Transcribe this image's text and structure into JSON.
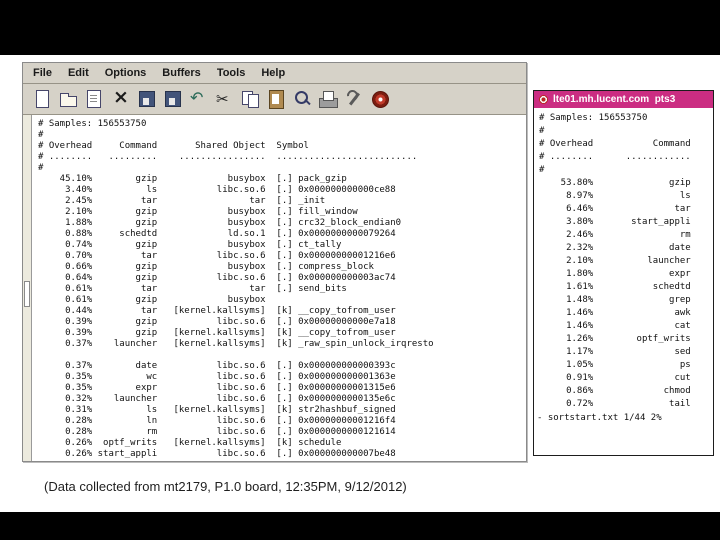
{
  "slide": {
    "caption": "(Data collected from mt2179, P1.0 board, 12:35PM, 9/12/2012)"
  },
  "editor": {
    "menu": [
      "File",
      "Edit",
      "Options",
      "Buffers",
      "Tools",
      "Help"
    ],
    "toolbar_icons": [
      "new-file",
      "open-folder",
      "dired",
      "close-buffer",
      "save",
      "save-as",
      "undo",
      "cut",
      "copy",
      "paste",
      "search",
      "print",
      "customize",
      "help"
    ],
    "lines": [
      {
        "full": "# Samples: 156553750"
      },
      {
        "full": "#"
      },
      {
        "overhead": "# Overhead",
        "command": "Command",
        "object": "Shared Object",
        "symbol": "Symbol"
      },
      {
        "overhead": "# ........",
        "command": ".........",
        "object": "................",
        "symbol": ".........................."
      },
      {
        "full": "#"
      },
      {
        "overhead": "45.10%",
        "command": "gzip",
        "object": "busybox",
        "symbol": "[.] pack_gzip"
      },
      {
        "overhead": "3.40%",
        "command": "ls",
        "object": "libc.so.6",
        "symbol": "[.] 0x000000000000ce88"
      },
      {
        "overhead": "2.45%",
        "command": "tar",
        "object": "tar",
        "symbol": "[.] _init"
      },
      {
        "overhead": "2.10%",
        "command": "gzip",
        "object": "busybox",
        "symbol": "[.] fill_window"
      },
      {
        "overhead": "1.88%",
        "command": "gzip",
        "object": "busybox",
        "symbol": "[.] crc32_block_endian0"
      },
      {
        "overhead": "0.88%",
        "command": "schedtd",
        "object": "ld.so.1",
        "symbol": "[.] 0x0000000000079264"
      },
      {
        "overhead": "0.74%",
        "command": "gzip",
        "object": "busybox",
        "symbol": "[.] ct_tally"
      },
      {
        "overhead": "0.70%",
        "command": "tar",
        "object": "libc.so.6",
        "symbol": "[.] 0x00000000001216e6"
      },
      {
        "overhead": "0.66%",
        "command": "gzip",
        "object": "busybox",
        "symbol": "[.] compress_block"
      },
      {
        "overhead": "0.64%",
        "command": "gzip",
        "object": "libc.so.6",
        "symbol": "[.] 0x000000000003ac74"
      },
      {
        "overhead": "0.61%",
        "command": "tar",
        "object": "tar",
        "symbol": "[.] send_bits"
      },
      {
        "overhead": "0.61%",
        "command": "gzip",
        "object": "busybox",
        "symbol": ""
      },
      {
        "overhead": "0.44%",
        "command": "tar",
        "object": "[kernel.kallsyms]",
        "symbol": "[k] __copy_tofrom_user"
      },
      {
        "overhead": "0.39%",
        "command": "gzip",
        "object": "libc.so.6",
        "symbol": "[.] 0x00000000000e7a18"
      },
      {
        "overhead": "0.39%",
        "command": "gzip",
        "object": "[kernel.kallsyms]",
        "symbol": "[k] __copy_tofrom_user"
      },
      {
        "overhead": "0.37%",
        "command": "launcher",
        "object": "[kernel.kallsyms]",
        "symbol": "[k] _raw_spin_unlock_irqresto"
      },
      {
        "full": ""
      },
      {
        "overhead": "0.37%",
        "command": "date",
        "object": "libc.so.6",
        "symbol": "[.] 0x000000000000393c"
      },
      {
        "overhead": "0.35%",
        "command": "wc",
        "object": "libc.so.6",
        "symbol": "[.] 0x000000000001363e"
      },
      {
        "overhead": "0.35%",
        "command": "expr",
        "object": "libc.so.6",
        "symbol": "[.] 0x00000000001315e6"
      },
      {
        "overhead": "0.32%",
        "command": "launcher",
        "object": "libc.so.6",
        "symbol": "[.] 0x0000000000135e6c"
      },
      {
        "overhead": "0.31%",
        "command": "ls",
        "object": "[kernel.kallsyms]",
        "symbol": "[k] str2hashbuf_signed"
      },
      {
        "overhead": "0.28%",
        "command": "ln",
        "object": "libc.so.6",
        "symbol": "[.] 0x00000000001216f4"
      },
      {
        "overhead": "0.28%",
        "command": "rm",
        "object": "libc.so.6",
        "symbol": "[.] 0x0000000000121614"
      },
      {
        "overhead": "0.26%",
        "command": "optf_writs",
        "object": "[kernel.kallsyms]",
        "symbol": "[k] schedule"
      },
      {
        "overhead": "0.26%",
        "command": "start_appli",
        "object": "libc.so.6",
        "symbol": "[.] 0x000000000007be48"
      }
    ]
  },
  "terminal": {
    "title": "lte01.mh.lucent.com  pts3",
    "lines": [
      {
        "full": "# Samples: 156553750"
      },
      {
        "full": "#"
      },
      {
        "overhead": "# Overhead",
        "command": "Command"
      },
      {
        "overhead": "# ........",
        "command": "............"
      },
      {
        "full": "#"
      },
      {
        "overhead": "53.80%",
        "command": "gzip"
      },
      {
        "overhead": "8.97%",
        "command": "ls"
      },
      {
        "overhead": "6.46%",
        "command": "tar"
      },
      {
        "overhead": "3.80%",
        "command": "start_appli"
      },
      {
        "overhead": "2.46%",
        "command": "rm"
      },
      {
        "overhead": "2.32%",
        "command": "date"
      },
      {
        "overhead": "2.10%",
        "command": "launcher"
      },
      {
        "overhead": "1.80%",
        "command": "expr"
      },
      {
        "overhead": "1.61%",
        "command": "schedtd"
      },
      {
        "overhead": "1.48%",
        "command": "grep"
      },
      {
        "overhead": "1.46%",
        "command": "awk"
      },
      {
        "overhead": "1.46%",
        "command": "cat"
      },
      {
        "overhead": "1.26%",
        "command": "optf_writs"
      },
      {
        "overhead": "1.17%",
        "command": "sed"
      },
      {
        "overhead": "1.05%",
        "command": "ps"
      },
      {
        "overhead": "0.91%",
        "command": "cut"
      },
      {
        "overhead": "0.86%",
        "command": "chmod"
      },
      {
        "overhead": "0.72%",
        "command": "tail"
      }
    ],
    "status": "- sortstart.txt 1/44 2%"
  }
}
